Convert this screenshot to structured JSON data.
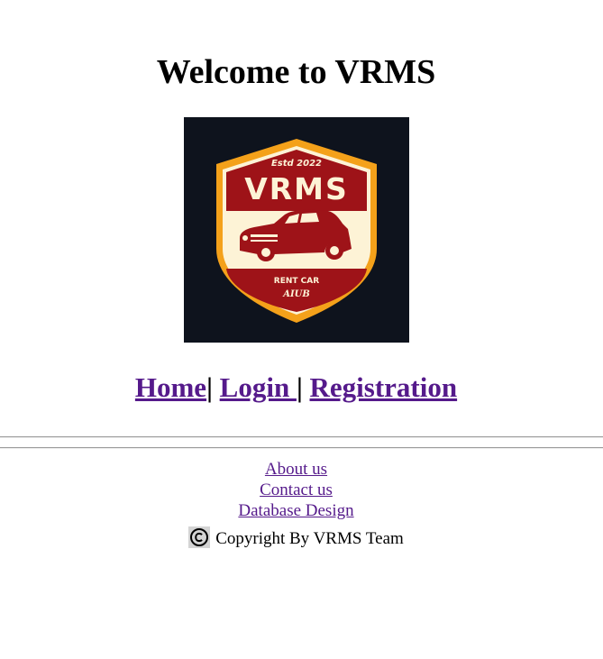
{
  "page": {
    "heading": "Welcome to VRMS"
  },
  "logo": {
    "established": "Estd 2022",
    "brand": "VRMS",
    "tagline": "RENT CAR",
    "sub": "AIUB",
    "colors": {
      "background": "#0e131d",
      "shield_border": "#f4a11a",
      "red": "#9e1318",
      "cream": "#fdf3d6"
    }
  },
  "nav": {
    "links": [
      "Home",
      "Login ",
      "Registration"
    ],
    "separator": "|",
    "link_color": "#551a8b"
  },
  "footer": {
    "links": [
      "About us",
      "Contact us",
      "Database Design"
    ],
    "copyright_text": "Copyright By VRMS Team",
    "copyright_icon": "copyright-icon"
  }
}
